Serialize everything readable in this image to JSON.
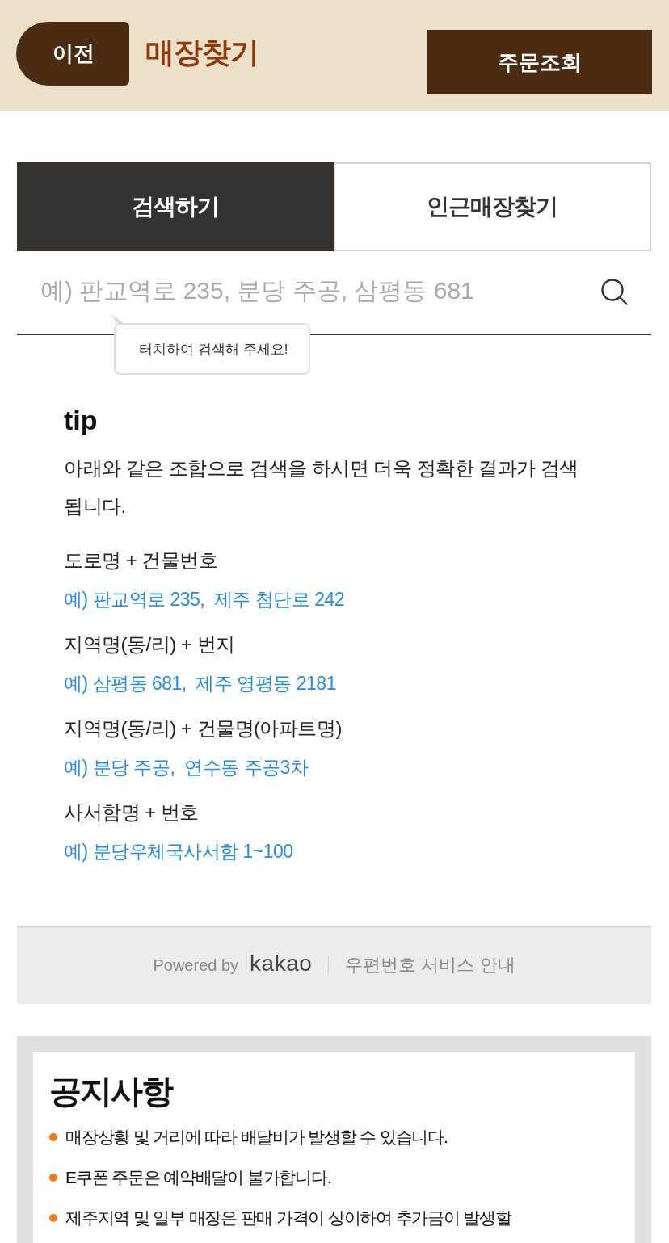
{
  "header": {
    "back_button": "이전",
    "title": "매장찾기",
    "order_button": "주문조회"
  },
  "tabs": [
    {
      "label": "검색하기",
      "selected": true
    },
    {
      "label": "인근매장찾기",
      "selected": false
    }
  ],
  "search": {
    "placeholder": "예) 판교역로 235, 분당 주공, 삼평동 681",
    "tooltip": "터치하여 검색해 주세요!"
  },
  "tip": {
    "title": "tip",
    "description": "아래와 같은 조합으로 검색을 하시면 더욱 정확한 결과가 검색 됩니다.",
    "items": [
      {
        "label": "도로명 + 건물번호",
        "example": "예) 판교역로 235,  제주 첨단로 242"
      },
      {
        "label": "지역명(동/리) + 번지",
        "example": "예) 삼평동 681,  제주 영평동 2181"
      },
      {
        "label": "지역명(동/리) + 건물명(아파트명)",
        "example": "예) 분당 주공,  연수동 주공3차"
      },
      {
        "label": "사서함명 + 번호",
        "example": "예) 분당우체국사서함 1~100"
      }
    ]
  },
  "powered": {
    "prefix": "Powered by",
    "logo": "kakao",
    "link": "우편번호 서비스 안내"
  },
  "notice": {
    "title": "공지사항",
    "items": [
      "매장상황 및 거리에 따라 배달비가 발생할 수 있습니다.",
      "E쿠폰 주문은 예약배달이 불가합니다.",
      "제주지역 및 일부 매장은 판매 가격이 상이하여 추가금이 발생할"
    ]
  }
}
